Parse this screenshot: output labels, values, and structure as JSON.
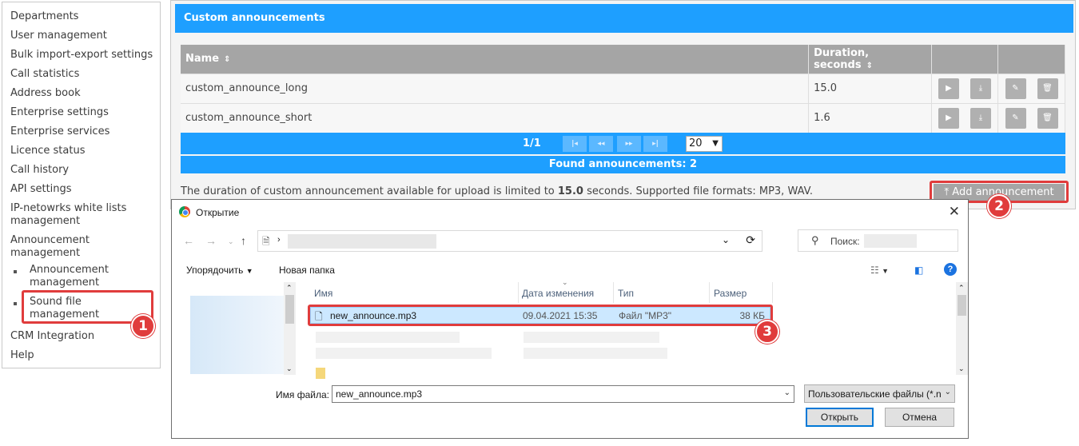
{
  "sidebar": {
    "items": [
      {
        "label": "Departments"
      },
      {
        "label": "User management"
      },
      {
        "label": "Bulk import-export settings"
      },
      {
        "label": "Call statistics"
      },
      {
        "label": "Address book"
      },
      {
        "label": "Enterprise settings"
      },
      {
        "label": "Enterprise services"
      },
      {
        "label": "Licence status"
      },
      {
        "label": "Call history"
      },
      {
        "label": "API settings"
      },
      {
        "label": "IP-netowrks white lists management"
      },
      {
        "label": "Announcement management"
      }
    ],
    "subitems": [
      {
        "label": "Announcement management"
      },
      {
        "label": "Sound file management"
      }
    ],
    "bottom_items": [
      {
        "label": "CRM Integration"
      },
      {
        "label": "Help"
      }
    ]
  },
  "panel": {
    "title": "Custom announcements",
    "columns": {
      "name": "Name",
      "duration": "Duration, seconds"
    },
    "rows": [
      {
        "name": "custom_announce_long",
        "duration": "15.0"
      },
      {
        "name": "custom_announce_short",
        "duration": "1.6"
      }
    ],
    "pager": {
      "label": "1/1",
      "page_size": "20"
    },
    "found": "Found announcements:  2",
    "note_prefix": "The duration of custom announcement available for upload is limited to ",
    "note_limit": "15.0",
    "note_suffix": " seconds. Supported file formats: MP3, WAV.",
    "add_button": "Add announcement"
  },
  "dialog": {
    "title": "Открытие",
    "search_label": "Поиск:",
    "toolbar": {
      "organize": "Упорядочить",
      "new_folder": "Новая папка"
    },
    "columns": {
      "name": "Имя",
      "date": "Дата изменения",
      "type": "Тип",
      "size": "Размер"
    },
    "file": {
      "name": "new_announce.mp3",
      "date": "09.04.2021 15:35",
      "type": "Файл \"MP3\"",
      "size": "38 КБ"
    },
    "filename_label": "Имя файла:",
    "filename_value": "new_announce.mp3",
    "filter": "Пользовательские файлы (*.n",
    "open_button": "Открыть",
    "cancel_button": "Отмена"
  },
  "badges": [
    "1",
    "2",
    "3"
  ],
  "colors": {
    "accent": "#1e9fff",
    "header_gray": "#a5a5a5",
    "highlight": "#e03c3c",
    "selection": "#cce8ff"
  }
}
